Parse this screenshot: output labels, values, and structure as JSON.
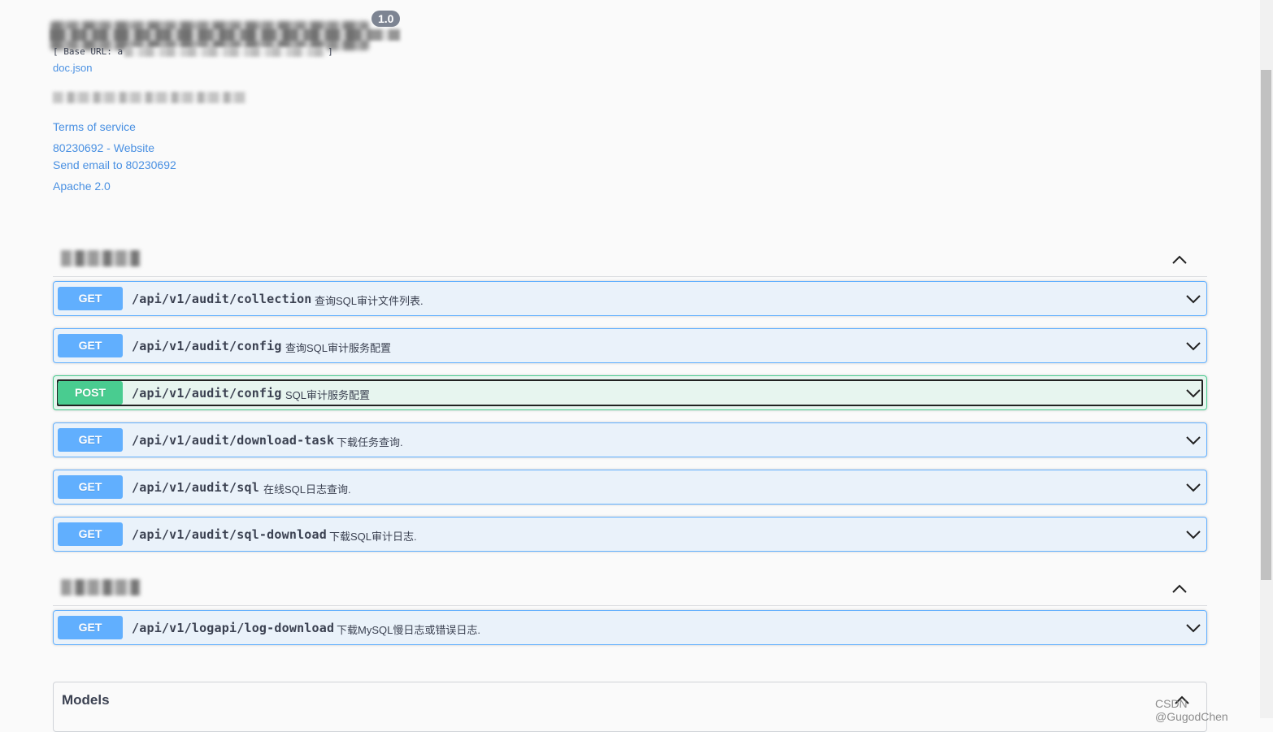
{
  "info": {
    "version": "1.0",
    "base_url_prefix": "[ Base URL: a",
    "base_url_suffix": "]",
    "doc_link": "doc.json",
    "terms": "Terms of service",
    "website": "80230692 - Website",
    "email": "Send email to 80230692",
    "license": "Apache 2.0"
  },
  "sections": [
    {
      "operations": [
        {
          "method": "GET",
          "path": "/api/v1/audit/collection",
          "summary": "查询SQL审计文件列表."
        },
        {
          "method": "GET",
          "path": "/api/v1/audit/config",
          "summary": "查询SQL审计服务配置"
        },
        {
          "method": "POST",
          "path": "/api/v1/audit/config",
          "summary": "SQL审计服务配置"
        },
        {
          "method": "GET",
          "path": "/api/v1/audit/download-task",
          "summary": "下载任务查询."
        },
        {
          "method": "GET",
          "path": "/api/v1/audit/sql",
          "summary": "在线SQL日志查询."
        },
        {
          "method": "GET",
          "path": "/api/v1/audit/sql-download",
          "summary": "下载SQL审计日志."
        }
      ]
    },
    {
      "operations": [
        {
          "method": "GET",
          "path": "/api/v1/logapi/log-download",
          "summary": "下载MySQL慢日志或错误日志."
        }
      ]
    }
  ],
  "models": {
    "title": "Models"
  },
  "watermark": "CSDN @GugodChen",
  "colors": {
    "get": "#61affe",
    "post": "#49cc90",
    "link": "#4990e2"
  }
}
